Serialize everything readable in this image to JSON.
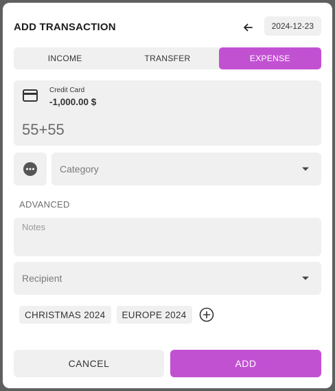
{
  "dialog": {
    "title": "ADD TRANSACTION",
    "date": "2024-12-23"
  },
  "tabs": [
    {
      "label": "INCOME",
      "active": false
    },
    {
      "label": "TRANSFER",
      "active": false
    },
    {
      "label": "EXPENSE",
      "active": true
    }
  ],
  "account": {
    "name": "Credit Card",
    "balance": "-1,000.00 $",
    "icon": "credit-card-icon"
  },
  "amount": {
    "value": "55+55"
  },
  "category": {
    "icon": "more-horizontal-icon",
    "placeholder": "Category"
  },
  "advanced": {
    "label": "ADVANCED",
    "notes_placeholder": "Notes",
    "recipient_placeholder": "Recipient"
  },
  "tags": [
    "CHRISTMAS 2024",
    "EUROPE 2024"
  ],
  "actions": {
    "cancel": "CANCEL",
    "add": "ADD"
  },
  "colors": {
    "accent": "#c251d2",
    "field_bg": "#f0f0f0",
    "backdrop": "#5f5f5f"
  }
}
